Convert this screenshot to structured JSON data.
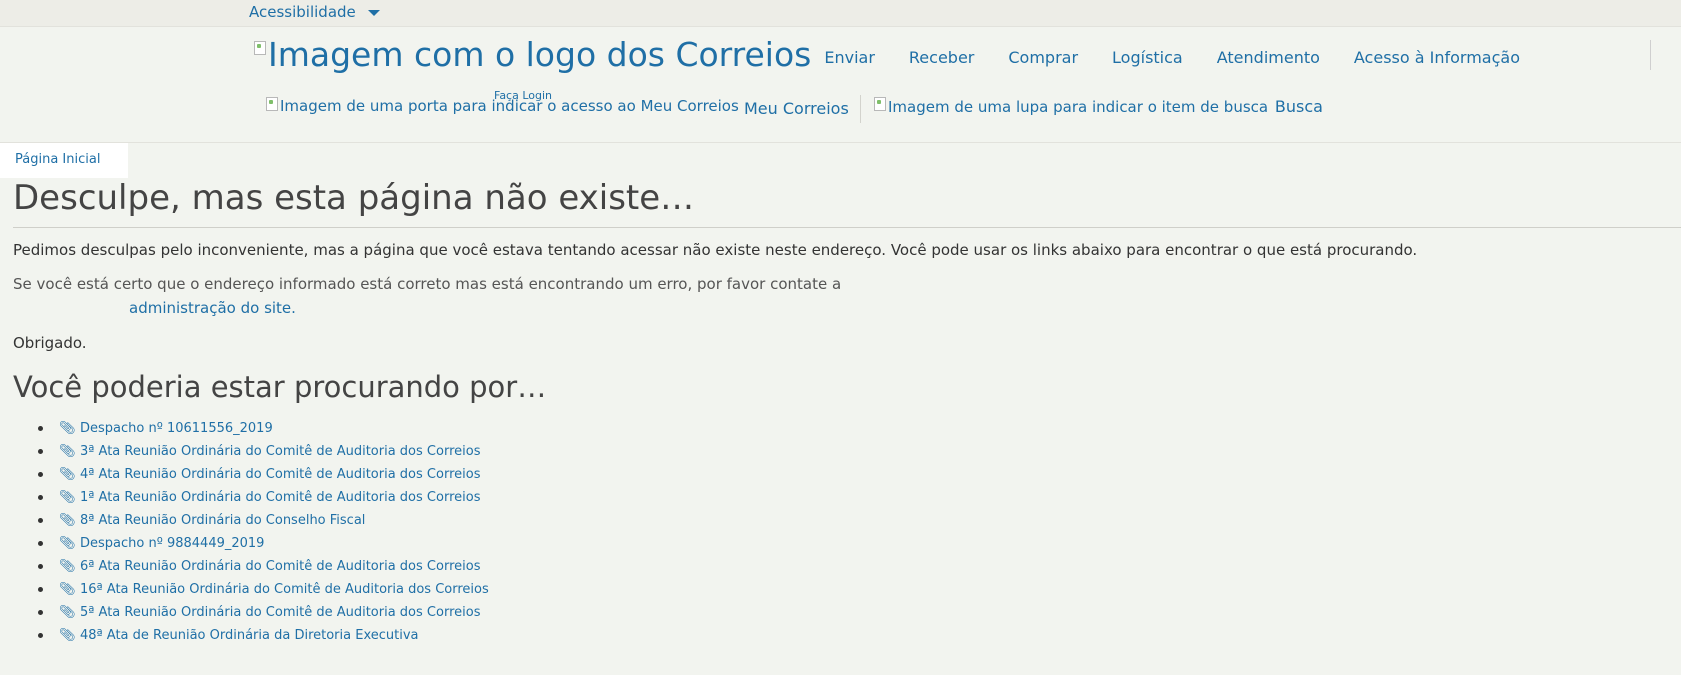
{
  "accessibility": {
    "label": "Acessibilidade"
  },
  "header": {
    "logo_alt": "Imagem com o logo dos Correios",
    "nav": [
      {
        "label": "Enviar"
      },
      {
        "label": "Receber"
      },
      {
        "label": "Comprar"
      },
      {
        "label": "Logística"
      },
      {
        "label": "Atendimento"
      },
      {
        "label": "Acesso à Informação"
      }
    ],
    "login_hint": "Faça Login",
    "door_alt": "Imagem de uma porta para indicar o acesso ao Meu Correios",
    "meu_correios": "Meu Correios",
    "search_alt": "Imagem de uma lupa para indicar o item de busca",
    "search_label": "Busca"
  },
  "breadcrumb": {
    "home": "Página Inicial"
  },
  "content": {
    "title": "Desculpe, mas esta página não existe…",
    "p1": "Pedimos desculpas pelo inconveniente, mas a página que você estava tentando acessar não existe neste endereço. Você pode usar os links abaixo para encontrar o que está procurando.",
    "p2": "Se você está certo que o endereço informado está correto mas está encontrando um erro, por favor contate a",
    "p2_link": "administração do site.",
    "p3": "Obrigado.",
    "subtitle": "Você poderia estar procurando por…",
    "suggestions": [
      "Despacho nº 10611556_2019",
      "3ª Ata Reunião Ordinária do Comitê de Auditoria dos Correios",
      "4ª Ata Reunião Ordinária do Comitê de Auditoria dos Correios",
      "1ª Ata Reunião Ordinária do Comitê de Auditoria dos Correios",
      "8ª Ata Reunião Ordinária do Conselho Fiscal",
      "Despacho nº 9884449_2019",
      "6ª Ata Reunião Ordinária do Comitê de Auditoria dos Correios",
      "16ª Ata Reunião Ordinária do Comitê de Auditoria dos Correios",
      "5ª Ata Reunião Ordinária do Comitê de Auditoria dos Correios",
      "48ª Ata de Reunião Ordinária da Diretoria Executiva"
    ]
  },
  "colors": {
    "link": "#1f6fa6",
    "background": "#f2f4ef",
    "text": "#333333"
  },
  "icons": {
    "attachment": "paperclip-icon",
    "dropdown": "chevron-down-icon"
  }
}
